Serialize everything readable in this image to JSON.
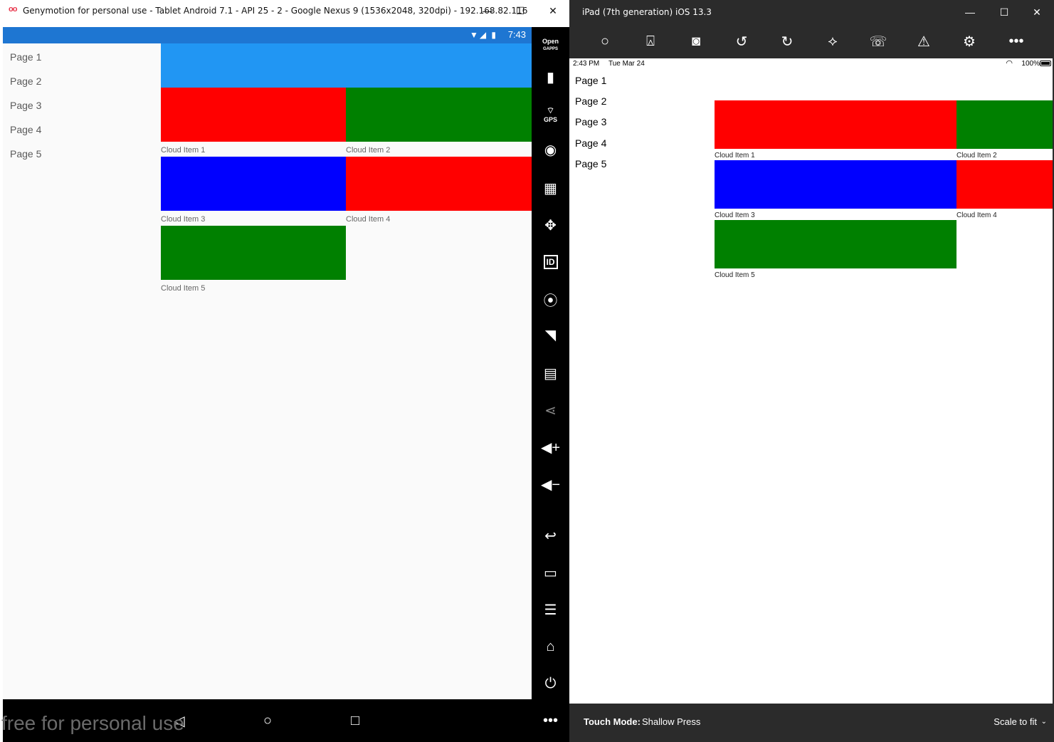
{
  "genymotion": {
    "logo": "oo",
    "title": "Genymotion for personal use - Tablet Android 7.1 - API 25 - 2 - Google Nexus 9 (1536x2048, 320dpi) - 192.168.82.116",
    "controls": {
      "minimize": "—",
      "maximize": "☐",
      "close": "✕"
    },
    "watermark": "free for personal use",
    "sidebar": {
      "open_gapps_line1": "Open",
      "open_gapps_line2": "GAPPS",
      "icons": [
        "battery-icon",
        "gps-icon",
        "webcam-icon",
        "capture-icon",
        "remote-control-icon",
        "device-id-icon",
        "disk-io-icon",
        "network-icon",
        "sms-icon",
        "share-icon",
        "volume-up-icon",
        "volume-down-icon",
        "back-icon",
        "recent-apps-icon",
        "menu-icon",
        "home-icon",
        "power-icon",
        "more-icon"
      ],
      "gps_label": "GPS",
      "id_label": "ID",
      "more_label": "•••"
    }
  },
  "android": {
    "status_time": "7:43",
    "menu": [
      "Page 1",
      "Page 2",
      "Page 3",
      "Page 4",
      "Page 5"
    ],
    "header_color": "#2196f3",
    "tiles": [
      {
        "label": "Cloud Item 1",
        "color": "#ff0000"
      },
      {
        "label": "Cloud Item 2",
        "color": "#008000"
      },
      {
        "label": "Cloud Item 3",
        "color": "#0000ff"
      },
      {
        "label": "Cloud Item 4",
        "color": "#ff0000"
      },
      {
        "label": "Cloud Item 5",
        "color": "#008000"
      }
    ],
    "nav": {
      "back": "◁",
      "home": "○",
      "recents": "□"
    }
  },
  "ios": {
    "title": "iPad (7th generation) iOS 13.3",
    "toolbar_icons": [
      "home-icon",
      "lock-icon",
      "screenshot-icon",
      "rotate-left-icon",
      "rotate-right-icon",
      "shake-icon",
      "siri-icon",
      "warning-icon",
      "settings-icon",
      "more-icon"
    ],
    "status": {
      "time": "2:43 PM",
      "date": "Tue Mar 24",
      "battery": "100%"
    },
    "menu": [
      "Page 1",
      "Page 2",
      "Page 3",
      "Page 4",
      "Page 5"
    ],
    "tiles": [
      {
        "label": "Cloud Item 1",
        "color": "#ff0000"
      },
      {
        "label": "Cloud Item 2",
        "color": "#008000"
      },
      {
        "label": "Cloud Item 3",
        "color": "#0000ff"
      },
      {
        "label": "Cloud Item 4",
        "color": "#ff0000"
      },
      {
        "label": "Cloud Item 5",
        "color": "#008000"
      }
    ],
    "touch_mode_label": "Touch Mode:",
    "touch_mode_value": "Shallow Press",
    "scale": "Scale to fit"
  }
}
